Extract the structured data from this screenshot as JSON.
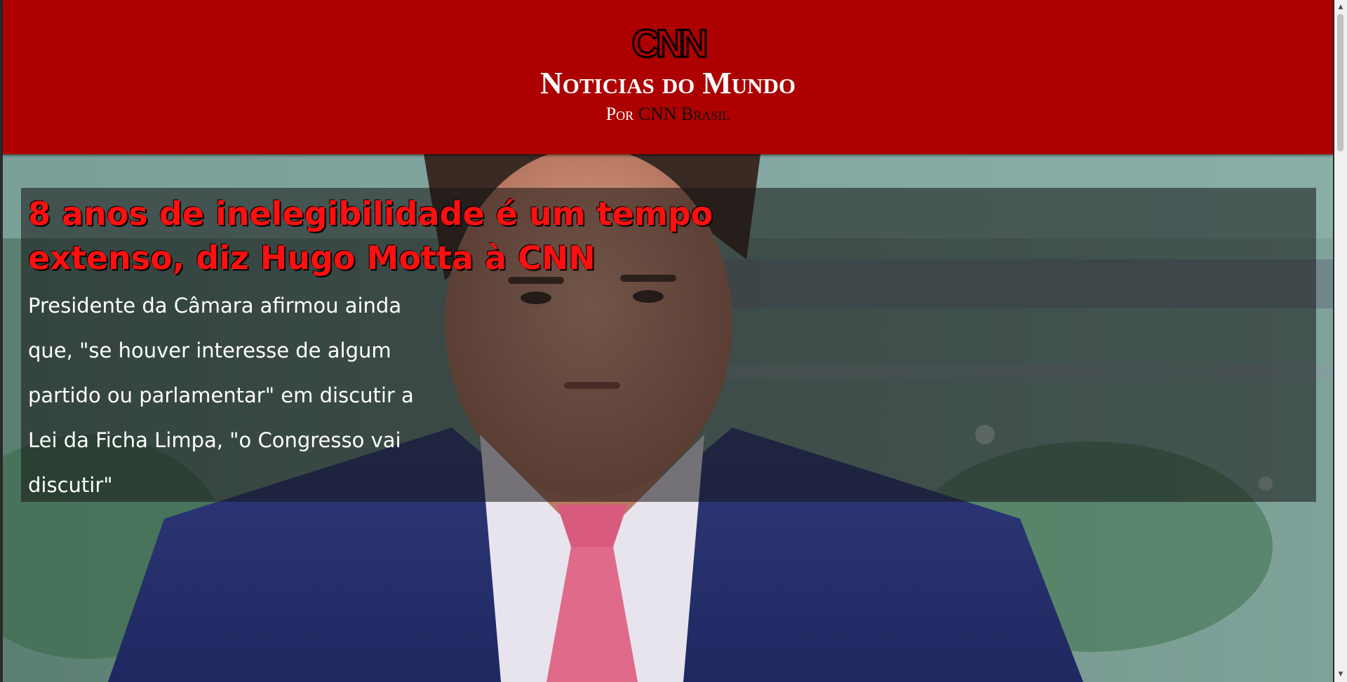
{
  "header": {
    "logo_text": "CNN",
    "title": "Noticias do Mundo",
    "subtitle_prefix": "Por",
    "subtitle_brand": "CNN Brasil"
  },
  "article": {
    "headline": "8 anos de inelegibilidade é um tempo extenso, diz Hugo Motta à CNN",
    "summary": "Presidente da Câmara afirmou ainda que, \"se houver interesse de algum partido ou parlamentar\" em discutir a Lei da Ficha Limpa, \"o Congresso vai discutir\""
  },
  "colors": {
    "header_bg": "#ad0000",
    "headline": "#ff1010",
    "overlay": "rgba(20,20,20,0.55)"
  },
  "scrollbar": {
    "up_icon": "triangle-up",
    "down_icon": "triangle-down"
  }
}
